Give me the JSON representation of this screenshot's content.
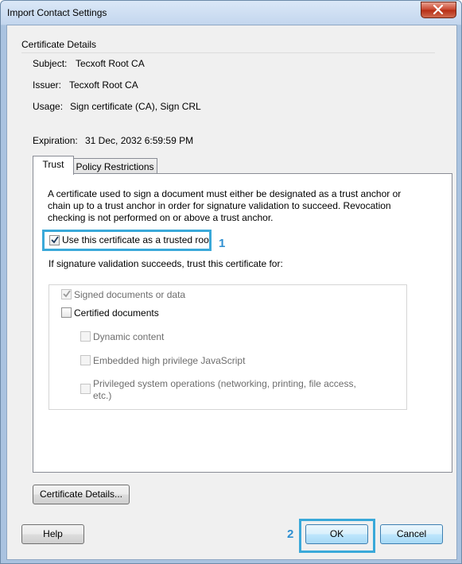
{
  "window": {
    "title": "Import Contact Settings"
  },
  "details": {
    "group_title": "Certificate Details",
    "subject_label": "Subject:",
    "subject_value": "Tecxoft Root CA",
    "issuer_label": "Issuer:",
    "issuer_value": "Tecxoft Root CA",
    "usage_label": "Usage:",
    "usage_value": "Sign certificate (CA), Sign CRL",
    "expiration_label": "Expiration:",
    "expiration_value": "31 Dec, 2032 6:59:59 PM"
  },
  "tabs": [
    {
      "label": "Trust",
      "active": true
    },
    {
      "label": "Policy Restrictions",
      "active": false
    }
  ],
  "trust": {
    "description": "A certificate used to sign a document must either be designated as a trust anchor or chain up to a trust anchor in order for signature validation to succeed.  Revocation checking is not performed on or above a trust anchor.",
    "trusted_root_label": "Use this certificate as a trusted root",
    "trusted_root_checked": true,
    "trust_for_label": "If signature validation succeeds, trust this certificate for:",
    "options": [
      {
        "label": "Signed documents or data",
        "checked": true,
        "enabled": false
      },
      {
        "label": "Certified documents",
        "checked": false,
        "enabled": true
      },
      {
        "label": "Dynamic content",
        "checked": false,
        "enabled": false
      },
      {
        "label": "Embedded high privilege JavaScript",
        "checked": false,
        "enabled": false
      },
      {
        "label": "Privileged system operations (networking, printing, file access, etc.)",
        "checked": false,
        "enabled": false
      }
    ]
  },
  "annotations": {
    "step1": "1",
    "step2": "2",
    "highlight_color": "#3aa9d9"
  },
  "buttons": {
    "certificate_details": "Certificate Details...",
    "help": "Help",
    "ok": "OK",
    "cancel": "Cancel"
  }
}
